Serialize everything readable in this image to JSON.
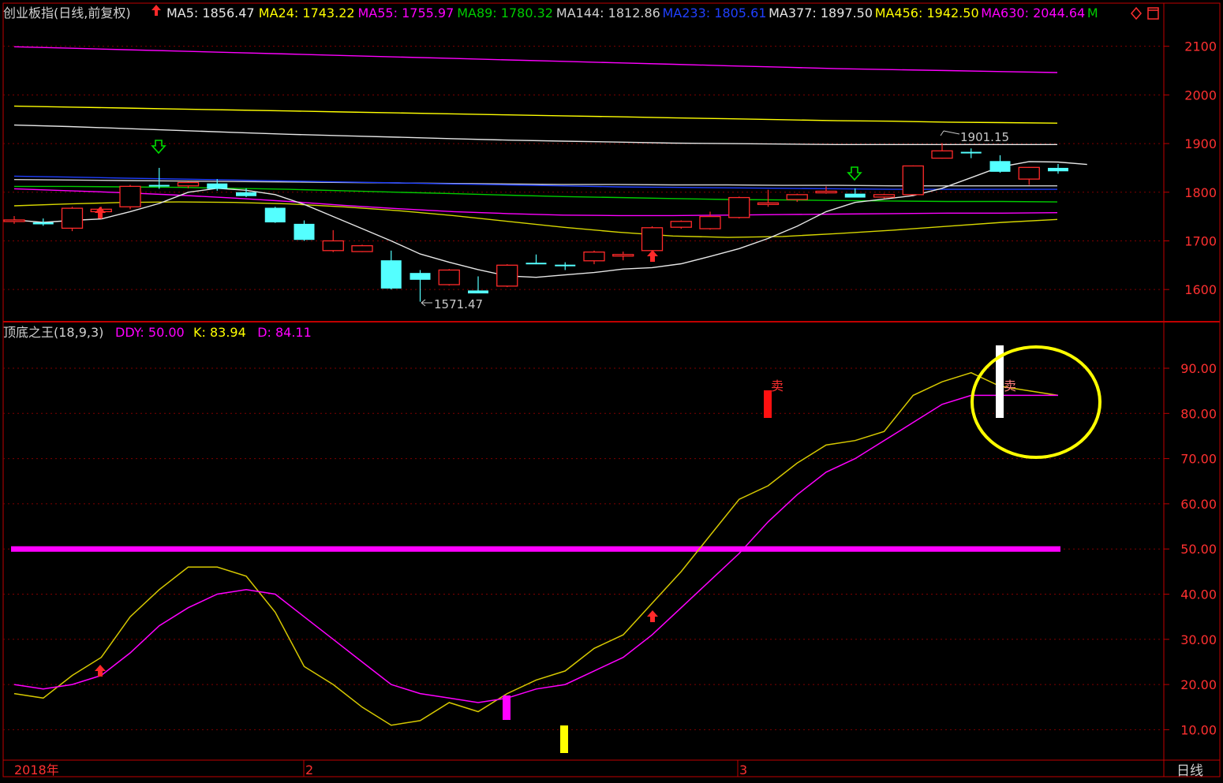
{
  "colors": {
    "background": "#000000",
    "frame": "#c00000",
    "grid": "#800000",
    "axis_text": "#ff3030",
    "up": "#ff2a2a",
    "down": "#54ffff",
    "white": "#e6e6e6",
    "yellow": "#d6d600",
    "magenta": "#ff00ff",
    "green": "#00cc00",
    "blue": "#2040ff",
    "k_line": "#d6c800",
    "d_line": "#ff00ff",
    "ddy_line": "#ff00ff",
    "circle": "#ffff00"
  },
  "top_panel": {
    "title": "创业板指(日线,前复权)",
    "legend": [
      {
        "label": "MA5: 1856.47",
        "color": "#e6e6e6"
      },
      {
        "label": "MA24: 1743.22",
        "color": "#ffff00"
      },
      {
        "label": "MA55: 1755.97",
        "color": "#ff00ff"
      },
      {
        "label": "MA89: 1780.32",
        "color": "#00cc00"
      },
      {
        "label": "MA144: 1812.86",
        "color": "#d0d0d0"
      },
      {
        "label": "MA233: 1805.61",
        "color": "#2040ff"
      },
      {
        "label": "MA377: 1897.50",
        "color": "#e6e6e6"
      },
      {
        "label": "MA456: 1942.50",
        "color": "#ffff00"
      },
      {
        "label": "MA630: 2044.64",
        "color": "#ff00ff"
      },
      {
        "label": "M",
        "color": "#00cc00"
      }
    ],
    "y_ticks": [
      "2100",
      "2000",
      "1900",
      "1800",
      "1700",
      "1600"
    ],
    "high_label": "1901.15",
    "low_label": "1571.47"
  },
  "bottom_panel": {
    "title": "顶底之王(18,9,3)",
    "legend": [
      {
        "label": "DDY: 50.00",
        "color": "#ff00ff"
      },
      {
        "label": "K: 83.94",
        "color": "#ffff00"
      },
      {
        "label": "D: 84.11",
        "color": "#ff00ff"
      }
    ],
    "y_ticks": [
      "90.00",
      "80.00",
      "70.00",
      "60.00",
      "50.00",
      "40.00",
      "30.00",
      "20.00",
      "10.00"
    ],
    "sell_labels": [
      "卖",
      "卖"
    ]
  },
  "x_axis": {
    "labels": [
      "2018年",
      "2",
      "3"
    ],
    "period": "日线"
  },
  "chart_data": [
    {
      "type": "candlestick",
      "title": "创业板指(日线,前复权)",
      "ylim": [
        1550,
        2140
      ],
      "candles": [
        {
          "o": 1740,
          "h": 1751,
          "l": 1735,
          "c": 1743
        },
        {
          "o": 1738,
          "h": 1746,
          "l": 1731,
          "c": 1734
        },
        {
          "o": 1726,
          "h": 1770,
          "l": 1720,
          "c": 1767
        },
        {
          "o": 1760,
          "h": 1770,
          "l": 1745,
          "c": 1765
        },
        {
          "o": 1770,
          "h": 1815,
          "l": 1765,
          "c": 1812
        },
        {
          "o": 1815,
          "h": 1850,
          "l": 1807,
          "c": 1813
        },
        {
          "o": 1813,
          "h": 1822,
          "l": 1808,
          "c": 1820
        },
        {
          "o": 1818,
          "h": 1827,
          "l": 1803,
          "c": 1807
        },
        {
          "o": 1800,
          "h": 1808,
          "l": 1790,
          "c": 1792
        },
        {
          "o": 1768,
          "h": 1770,
          "l": 1737,
          "c": 1738
        },
        {
          "o": 1735,
          "h": 1742,
          "l": 1700,
          "c": 1702
        },
        {
          "o": 1680,
          "h": 1722,
          "l": 1677,
          "c": 1700
        },
        {
          "o": 1678,
          "h": 1692,
          "l": 1677,
          "c": 1690
        },
        {
          "o": 1660,
          "h": 1680,
          "l": 1600,
          "c": 1602
        },
        {
          "o": 1634,
          "h": 1640,
          "l": 1575,
          "c": 1620
        },
        {
          "o": 1610,
          "h": 1642,
          "l": 1608,
          "c": 1640
        },
        {
          "o": 1598,
          "h": 1627,
          "l": 1597,
          "c": 1592
        },
        {
          "o": 1607,
          "h": 1652,
          "l": 1605,
          "c": 1650
        },
        {
          "o": 1655,
          "h": 1672,
          "l": 1652,
          "c": 1654
        },
        {
          "o": 1651,
          "h": 1656,
          "l": 1640,
          "c": 1650
        },
        {
          "o": 1659,
          "h": 1680,
          "l": 1652,
          "c": 1677
        },
        {
          "o": 1670,
          "h": 1678,
          "l": 1660,
          "c": 1672
        },
        {
          "o": 1680,
          "h": 1730,
          "l": 1678,
          "c": 1727
        },
        {
          "o": 1728,
          "h": 1742,
          "l": 1725,
          "c": 1740
        },
        {
          "o": 1725,
          "h": 1760,
          "l": 1723,
          "c": 1750
        },
        {
          "o": 1748,
          "h": 1791,
          "l": 1746,
          "c": 1789
        },
        {
          "o": 1775,
          "h": 1805,
          "l": 1770,
          "c": 1778
        },
        {
          "o": 1785,
          "h": 1797,
          "l": 1780,
          "c": 1795
        },
        {
          "o": 1801,
          "h": 1812,
          "l": 1797,
          "c": 1802
        },
        {
          "o": 1797,
          "h": 1808,
          "l": 1792,
          "c": 1789
        },
        {
          "o": 1790,
          "h": 1797,
          "l": 1787,
          "c": 1795
        },
        {
          "o": 1795,
          "h": 1855,
          "l": 1794,
          "c": 1854
        },
        {
          "o": 1870,
          "h": 1901,
          "l": 1869,
          "c": 1885
        },
        {
          "o": 1883,
          "h": 1890,
          "l": 1870,
          "c": 1880
        },
        {
          "o": 1864,
          "h": 1876,
          "l": 1840,
          "c": 1842
        },
        {
          "o": 1827,
          "h": 1852,
          "l": 1815,
          "c": 1851
        },
        {
          "o": 1850,
          "h": 1858,
          "l": 1838,
          "c": 1843
        }
      ],
      "ma5": [
        1743,
        1738,
        1742,
        1745,
        1760,
        1777,
        1800,
        1808,
        1804,
        1795,
        1775,
        1750,
        1725,
        1700,
        1673,
        1656,
        1641,
        1628,
        1625,
        1630,
        1635,
        1642,
        1645,
        1653,
        1668,
        1684,
        1705,
        1730,
        1760,
        1779,
        1786,
        1793,
        1808,
        1830,
        1852,
        1863,
        1862,
        1857
      ],
      "ma_lines": [
        {
          "name": "MA24",
          "values": [
            1772,
            1776,
            1779,
            1780,
            1779,
            1776,
            1770,
            1762,
            1752,
            1740,
            1728,
            1718,
            1710,
            1707,
            1709,
            1715,
            1722,
            1730,
            1738,
            1744
          ]
        },
        {
          "name": "MA55",
          "values": [
            1807,
            1803,
            1799,
            1794,
            1788,
            1781,
            1773,
            1766,
            1760,
            1756,
            1753,
            1752,
            1752,
            1753,
            1754,
            1755,
            1756,
            1757,
            1757,
            1758
          ]
        },
        {
          "name": "MA89",
          "values": [
            1812,
            1812,
            1811,
            1810,
            1808,
            1806,
            1803,
            1800,
            1797,
            1794,
            1791,
            1789,
            1787,
            1785,
            1784,
            1783,
            1782,
            1781,
            1781,
            1780
          ]
        },
        {
          "name": "MA144",
          "values": [
            1826,
            1825,
            1824,
            1823,
            1822,
            1821,
            1820,
            1819,
            1818,
            1817,
            1816,
            1816,
            1815,
            1815,
            1814,
            1814,
            1813,
            1813,
            1813,
            1813
          ]
        },
        {
          "name": "MA233",
          "values": [
            1833,
            1831,
            1829,
            1827,
            1825,
            1823,
            1821,
            1819,
            1817,
            1815,
            1813,
            1811,
            1810,
            1809,
            1808,
            1807,
            1806,
            1806,
            1806,
            1806
          ]
        },
        {
          "name": "MA377",
          "values": [
            1938,
            1935,
            1931,
            1927,
            1923,
            1919,
            1916,
            1913,
            1910,
            1907,
            1905,
            1903,
            1901,
            1900,
            1899,
            1898,
            1898,
            1898,
            1898,
            1898
          ]
        },
        {
          "name": "MA456",
          "values": [
            1977,
            1975,
            1973,
            1971,
            1969,
            1967,
            1965,
            1963,
            1961,
            1959,
            1957,
            1955,
            1953,
            1951,
            1949,
            1947,
            1946,
            1944,
            1943,
            1942
          ]
        },
        {
          "name": "MA630",
          "values": [
            2099,
            2096,
            2093,
            2090,
            2087,
            2084,
            2081,
            2078,
            2075,
            2072,
            2069,
            2066,
            2063,
            2060,
            2057,
            2054,
            2052,
            2050,
            2048,
            2046
          ]
        }
      ]
    },
    {
      "type": "line",
      "title": "顶底之王(18,9,3)",
      "ylim": [
        2,
        98
      ],
      "series": [
        {
          "name": "K",
          "values": [
            18,
            17,
            22,
            26,
            35,
            41,
            46,
            46,
            44,
            36,
            24,
            20,
            15,
            11,
            12,
            16,
            14,
            18,
            21,
            23,
            28,
            31,
            38,
            45,
            53,
            61,
            64,
            69,
            73,
            74,
            76,
            84,
            87,
            89,
            86,
            85,
            84
          ]
        },
        {
          "name": "D",
          "values": [
            20,
            19,
            20,
            22,
            27,
            33,
            37,
            40,
            41,
            40,
            35,
            30,
            25,
            20,
            18,
            17,
            16,
            17,
            19,
            20,
            23,
            26,
            31,
            37,
            43,
            49,
            56,
            62,
            67,
            70,
            74,
            78,
            82,
            84,
            84,
            84,
            84
          ]
        },
        {
          "name": "DDY",
          "values": [
            50,
            50
          ]
        }
      ]
    }
  ]
}
